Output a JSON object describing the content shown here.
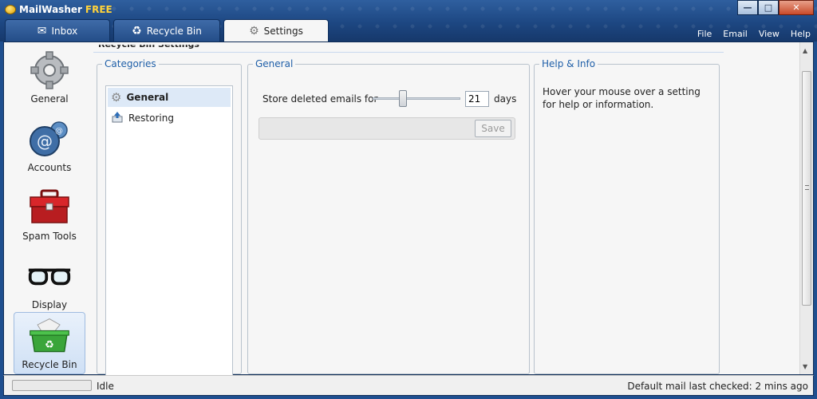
{
  "window": {
    "title": "MailWasher",
    "title_suffix": "FREE",
    "controls": [
      "minimize",
      "maximize",
      "close"
    ]
  },
  "tabs": [
    {
      "label": "Inbox",
      "icon": "envelope-icon"
    },
    {
      "label": "Recycle Bin",
      "icon": "recycle-icon"
    },
    {
      "label": "Settings",
      "icon": "gear-icon",
      "active": true
    }
  ],
  "menu": [
    "File",
    "Email",
    "View",
    "Help"
  ],
  "nav": [
    {
      "label": "General",
      "icon": "gear-icon"
    },
    {
      "label": "Accounts",
      "icon": "accounts-icon"
    },
    {
      "label": "Spam Tools",
      "icon": "toolbox-icon"
    },
    {
      "label": "Display",
      "icon": "glasses-icon"
    },
    {
      "label": "Recycle Bin",
      "icon": "recycle-bin-icon",
      "active": true
    }
  ],
  "page": {
    "title": "Recycle Bin Settings"
  },
  "categories": {
    "legend": "Categories",
    "items": [
      {
        "label": "General",
        "selected": true
      },
      {
        "label": "Restoring"
      }
    ]
  },
  "general": {
    "legend": "General",
    "store_label": "Store deleted emails for",
    "days_value": "21",
    "days_unit": "days",
    "slider_fraction": 0.35,
    "save_label": "Save"
  },
  "help": {
    "legend": "Help & Info",
    "text": "Hover your mouse over a setting for help or information."
  },
  "status": {
    "state": "Idle",
    "last_checked": "Default mail last checked: 2 mins ago"
  },
  "colors": {
    "accent": "#1f5fa8",
    "titlebar": "#1d4782"
  }
}
